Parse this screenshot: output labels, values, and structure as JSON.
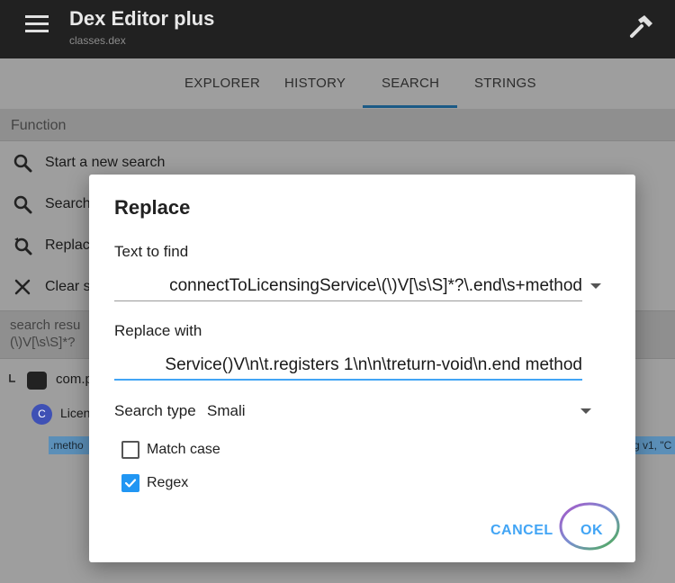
{
  "app": {
    "title": "Dex Editor plus",
    "subtitle": "classes.dex"
  },
  "tabs": [
    {
      "label": "EXPLORER"
    },
    {
      "label": "HISTORY"
    },
    {
      "label": "SEARCH",
      "selected": true
    },
    {
      "label": "STRINGS"
    }
  ],
  "function_section": {
    "header": "Function",
    "items": [
      {
        "label": "Start a new search",
        "icon": "search-icon"
      },
      {
        "label": "Search",
        "icon": "search-icon"
      },
      {
        "label": "Replac",
        "icon": "replace-icon"
      },
      {
        "label": "Clear s",
        "icon": "close-icon"
      }
    ]
  },
  "results": {
    "line1": "search resu",
    "line2": "(\\)V[\\s\\S]*?",
    "tree": [
      {
        "label": "com.p",
        "icon": "folder-icon"
      },
      {
        "label": "Licen",
        "icon": "class-icon",
        "icon_letter": "C"
      }
    ],
    "match_left": ".metho",
    "match_right": "g v1, \"C"
  },
  "dialog": {
    "title": "Replace",
    "find_label": "Text to find",
    "find_value": "connectToLicensingService\\(\\)V[\\s\\S]*?\\.end\\s+method",
    "replace_label": "Replace with",
    "replace_value": "Service()V\\n\\t.registers 1\\n\\n\\treturn-void\\n.end method",
    "search_type_label": "Search type",
    "search_type_value": "Smali",
    "match_case_label": "Match case",
    "match_case_checked": false,
    "regex_label": "Regex",
    "regex_checked": true,
    "cancel_label": "CANCEL",
    "ok_label": "OK"
  },
  "colors": {
    "appbar": "#212121",
    "accent": "#42a5f5",
    "tab_indicator": "#1b5a86",
    "ok_annotation": [
      "#a855c8",
      "#4caf50"
    ]
  }
}
